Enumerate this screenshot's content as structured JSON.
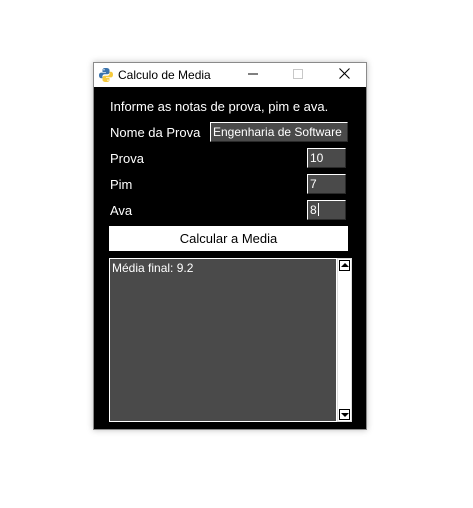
{
  "window": {
    "title": "Calculo de Media",
    "minimize_glyph": "—",
    "maximize_glyph": "☐",
    "close_glyph": "✕"
  },
  "form": {
    "instructions": "Informe as notas de prova, pim e ava.",
    "nome_prova_label": "Nome da Prova",
    "nome_prova_value": "Engenharia de Software",
    "prova_label": "Prova",
    "prova_value": "10",
    "pim_label": "Pim",
    "pim_value": "7",
    "ava_label": "Ava",
    "ava_value": "8"
  },
  "actions": {
    "calcular_label": "Calcular a Media"
  },
  "output": {
    "text": "Média final: 9.2"
  },
  "icons": {
    "app": "python-icon",
    "minimize": "minimize-icon",
    "maximize": "maximize-icon",
    "close": "close-icon",
    "scroll_up": "arrow-up-icon",
    "scroll_down": "arrow-down-icon"
  },
  "colors": {
    "window_bg": "#000000",
    "entry_bg": "#4a4a4a",
    "text": "#ffffff",
    "button_bg": "#ffffff"
  }
}
